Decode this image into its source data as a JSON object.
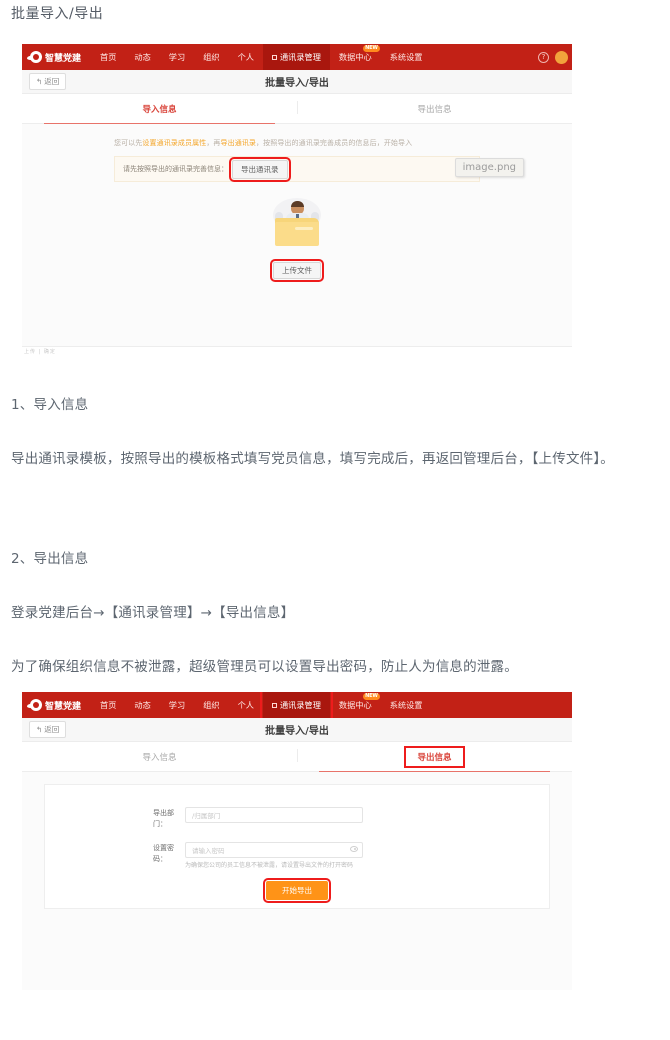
{
  "doc": {
    "title": "批量导入/导出",
    "section1_heading": "1、导入信息",
    "section1_body": "导出通讯录模板，按照导出的模板格式填写党员信息，填写完成后，再返回管理后台，【上传文件】。",
    "section2_heading": "2、导出信息",
    "section2_path": "登录党建后台→【通讯录管理】→【导出信息】",
    "section2_body": "为了确保组织信息不被泄露，超级管理员可以设置导出密码，防止人为信息的泄露。"
  },
  "nav": {
    "brand": "智慧党建",
    "items": [
      {
        "label": "首页",
        "icon": "",
        "active": false,
        "badge": ""
      },
      {
        "label": "动态",
        "icon": "",
        "active": false,
        "badge": ""
      },
      {
        "label": "学习",
        "icon": "",
        "active": false,
        "badge": ""
      },
      {
        "label": "组织",
        "icon": "",
        "active": false,
        "badge": ""
      },
      {
        "label": "个人",
        "icon": "",
        "active": false,
        "badge": ""
      },
      {
        "label": "通讯录管理",
        "icon": "square-icon",
        "active": true,
        "badge": ""
      },
      {
        "label": "数据中心",
        "icon": "",
        "active": false,
        "badge": "NEW"
      },
      {
        "label": "系统设置",
        "icon": "",
        "active": false,
        "badge": ""
      }
    ],
    "help_icon": "?",
    "colors": {
      "bar": "#c22116",
      "active": "#a9170e",
      "badge": "#ff8a1e"
    }
  },
  "subheader": {
    "back_label": "返回",
    "back_icon": "↰",
    "title": "批量导入/导出"
  },
  "tabs": {
    "import_label": "导入信息",
    "export_label": "导出信息"
  },
  "import_panel": {
    "notice_prefix": "您可以先",
    "notice_link1": "设置通讯录成员属性",
    "notice_mid": "，再",
    "notice_link2": "导出通讯录",
    "notice_suffix": "，按照导出的通讯录完善成员的信息后，开始导入",
    "export_row_text": "请先按照导出的通讯录完善信息：",
    "export_button": "导出通讯录",
    "image_tooltip": "image.png",
    "upload_button": "上传文件",
    "footer_mini": "上传 | 确定"
  },
  "export_panel": {
    "dept_label": "导出部门：",
    "dept_placeholder": "/归属部门",
    "password_label": "设置密码：",
    "password_placeholder": "请输入密码",
    "password_help": "为确保您公司的员工信息不被泄露，请设置导出文件的打开密码",
    "submit_label": "开始导出",
    "colors": {
      "submit": "#ff9317",
      "highlight": "#ee1c1c"
    }
  }
}
